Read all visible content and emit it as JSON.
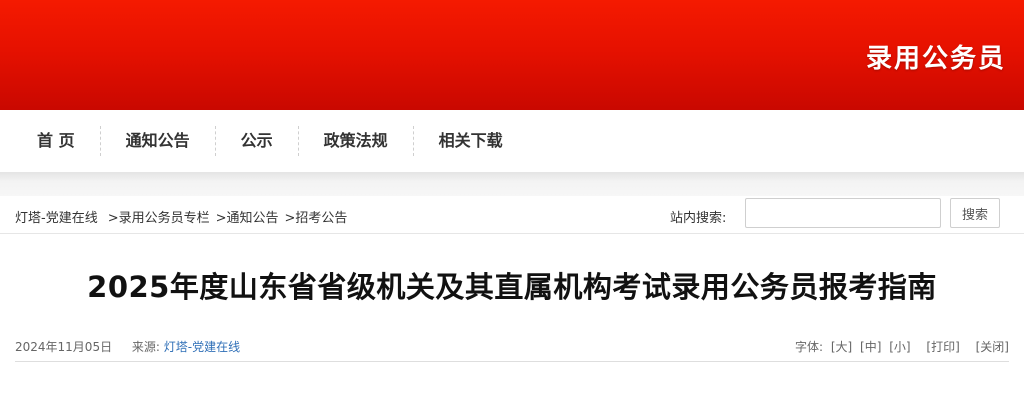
{
  "banner": {
    "title": "录用公务员"
  },
  "nav": {
    "items": [
      "首 页",
      "通知公告",
      "公示",
      "政策法规",
      "相关下载"
    ]
  },
  "breadcrumb": {
    "items": [
      "灯塔-党建在线",
      ">录用公务员专栏",
      ">通知公告",
      ">招考公告"
    ]
  },
  "search": {
    "label": "站内搜索:",
    "value": "",
    "button_label": "搜索"
  },
  "article": {
    "title": "2025年度山东省省级机关及其直属机构考试录用公务员报考指南",
    "date": "2024年11月05日",
    "source_label": "来源:",
    "source": "灯塔-党建在线",
    "font_label": "字体:",
    "font_large": "[大]",
    "font_medium": "[中]",
    "font_small": "[小]",
    "print": "[打印]",
    "close": "[关闭]"
  },
  "colors": {
    "banner_red": "#e61100",
    "link_blue": "#2f6fb7"
  }
}
